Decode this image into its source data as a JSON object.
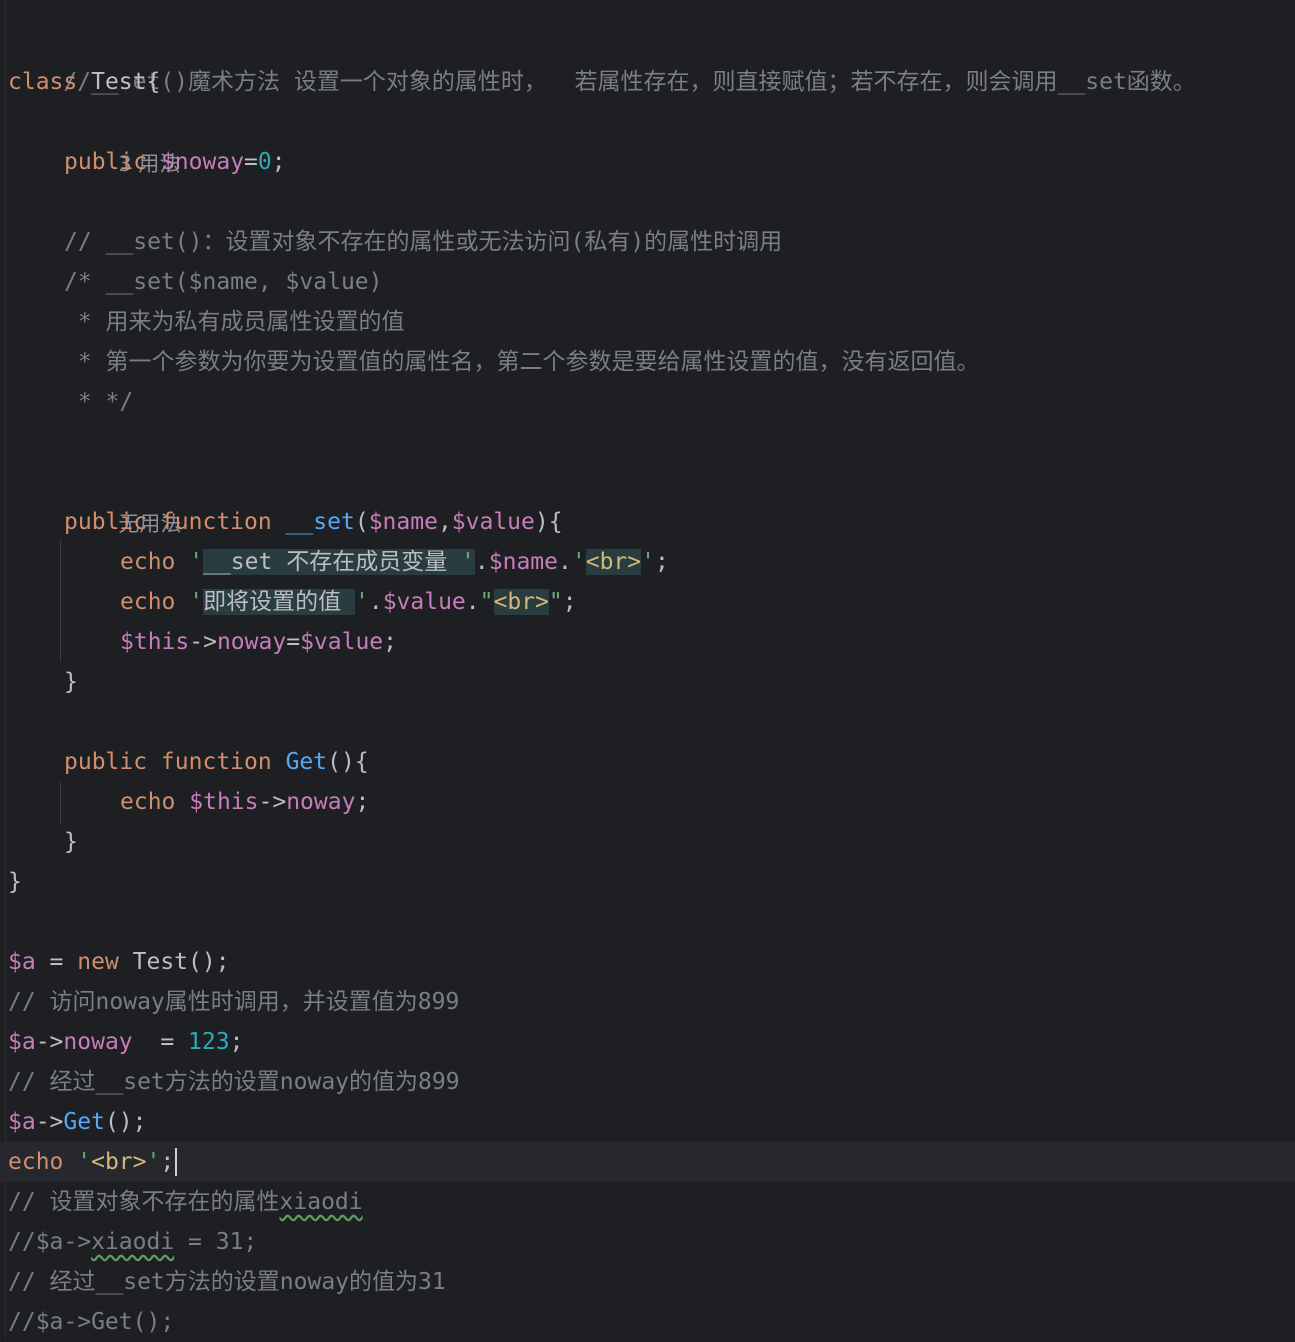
{
  "editor": {
    "lines": {
      "l1": "//__set()魔术方法 设置一个对象的属性时，  若属性存在，则直接赋值；若不存在，则会调用__set函数。",
      "l2_kw": "class",
      "l2_name": " Test{",
      "l3_hint": "3 用法",
      "l4_kw": "public",
      "l4_var": "$noway",
      "l4_eq": "=",
      "l4_num": "0",
      "l4_end": ";",
      "l6": "// __set()：设置对象不存在的属性或无法访问(私有)的属性时调用",
      "l7": "/* __set($name, $value)",
      "l8": " * 用来为私有成员属性设置的值",
      "l9": " * 第一个参数为你要为设置值的属性名，第二个参数是要给属性设置的值，没有返回值。",
      "l10": " * */",
      "l12_hint": "无用法",
      "l13_kw": "public function",
      "l13_fn": "__set",
      "l13_p1": "(",
      "l13_v1": "$name",
      "l13_c": ",",
      "l13_v2": "$value",
      "l13_end": "){",
      "l14_kw": "echo",
      "l14_q1": "'",
      "l14_s": "__set 不存在成员变量 ",
      "l14_q2": "'",
      "l14_dot": ".",
      "l14_var": "$name",
      "l14_dot2": ".",
      "l14_q3": "'",
      "l14_tag": "<br>",
      "l14_q4": "'",
      "l14_end": ";",
      "l15_kw": "echo",
      "l15_q1": "'",
      "l15_s": "即将设置的值 ",
      "l15_q2": "'",
      "l15_dot": ".",
      "l15_var": "$value",
      "l15_dot2": ".",
      "l15_q3": "\"",
      "l15_tag": "<br>",
      "l15_q4": "\"",
      "l15_end": ";",
      "l16_var": "$this",
      "l16_arrow": "->",
      "l16_prop": "noway",
      "l16_eq": "=",
      "l16_var2": "$value",
      "l16_end": ";",
      "l17": "}",
      "l19_kw": "public function",
      "l19_fn": "Get",
      "l19_end": "(){",
      "l20_kw": "echo",
      "l20_var": "$this",
      "l20_arrow": "->",
      "l20_prop": "noway",
      "l20_end": ";",
      "l21": "}",
      "l22": "}",
      "l24_var": "$a",
      "l24_eq": " = ",
      "l24_kw": "new",
      "l24_end": " Test();",
      "l25": "// 访问noway属性时调用，并设置值为899",
      "l26_var": "$a",
      "l26_arrow": "->",
      "l26_prop": "noway",
      "l26_eq": "  = ",
      "l26_num": "123",
      "l26_end": ";",
      "l27": "// 经过__set方法的设置noway的值为899",
      "l28_var": "$a",
      "l28_arrow": "->",
      "l28_fn": "Get",
      "l28_end": "();",
      "l29_kw": "echo",
      "l29_q1": "'",
      "l29_tag": "<br>",
      "l29_q2": "'",
      "l29_end": ";",
      "l30_a": "// 设置对象不存在的属性",
      "l30_b": "xiaodi",
      "l31_a": "//$a->",
      "l31_b": "xiaodi",
      "l31_c": " = 31;",
      "l32": "// 经过__set方法的设置noway的值为31",
      "l33": "//$a->Get();"
    }
  }
}
